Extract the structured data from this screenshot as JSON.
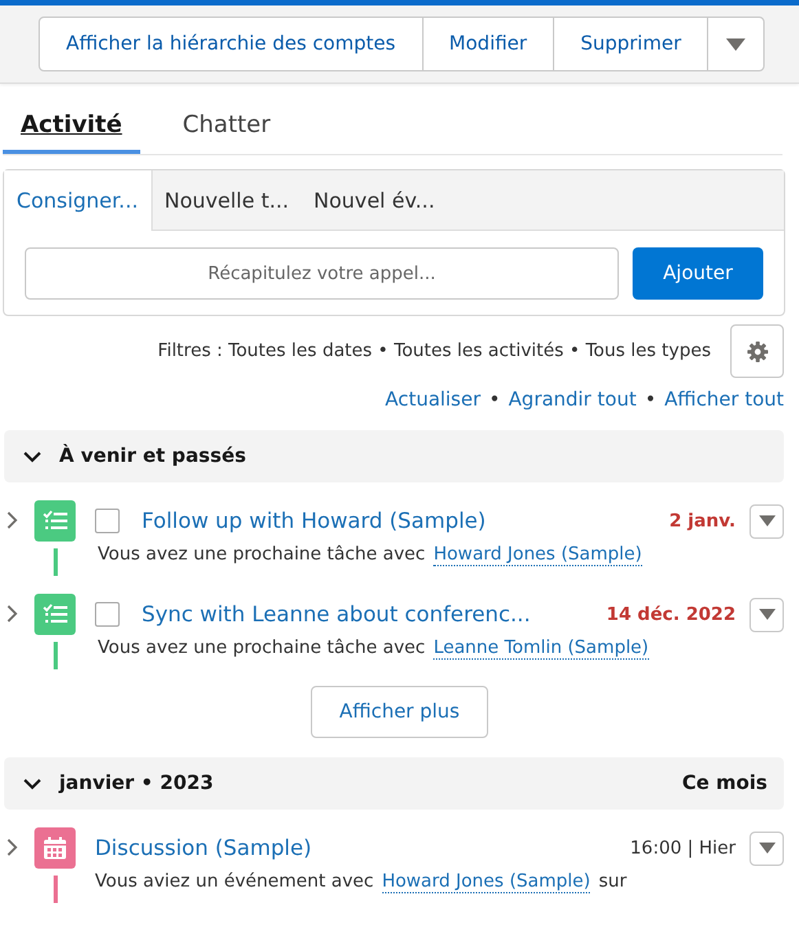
{
  "actions": {
    "buttons": [
      "Afficher la hiérarchie des comptes",
      "Modifier",
      "Supprimer"
    ]
  },
  "tabs": [
    {
      "label": "Activité",
      "selected": true
    },
    {
      "label": "Chatter",
      "selected": false
    }
  ],
  "composer": {
    "tabs": [
      {
        "label": "Consigner...",
        "selected": true
      },
      {
        "label": "Nouvelle t...",
        "selected": false
      },
      {
        "label": "Nouvel év...",
        "selected": false
      }
    ],
    "placeholder": "Récapitulez votre appel...",
    "button": "Ajouter"
  },
  "filters": "Filtres : Toutes les dates • Toutes les activités • Tous les types",
  "links": [
    "Actualiser",
    "Agrandir tout",
    "Afficher tout"
  ],
  "link_separator": "•",
  "sections": [
    {
      "title": "À venir et passés",
      "expanded": true,
      "items": [
        {
          "kind": "task",
          "title": "Follow up with Howard (Sample)",
          "date": "2 janv.",
          "overdue": true,
          "checked": false,
          "text": "Vous avez une prochaine tâche avec",
          "link": "Howard Jones (Sample)"
        },
        {
          "kind": "task",
          "title": "Sync with Leanne about conferenc...",
          "date": "14 déc. 2022",
          "overdue": true,
          "checked": false,
          "text": "Vous avez une prochaine tâche avec",
          "link": "Leanne Tomlin (Sample)"
        }
      ],
      "more_button": "Afficher plus"
    },
    {
      "title": "janvier • 2023",
      "badge": "Ce mois",
      "expanded": true,
      "items": [
        {
          "kind": "event",
          "title": "Discussion (Sample)",
          "date": "16:00 | Hier",
          "overdue": false,
          "text": "Vous aviez un événement avec",
          "link": "Howard Jones (Sample)",
          "suffix": "sur"
        }
      ]
    }
  ]
}
